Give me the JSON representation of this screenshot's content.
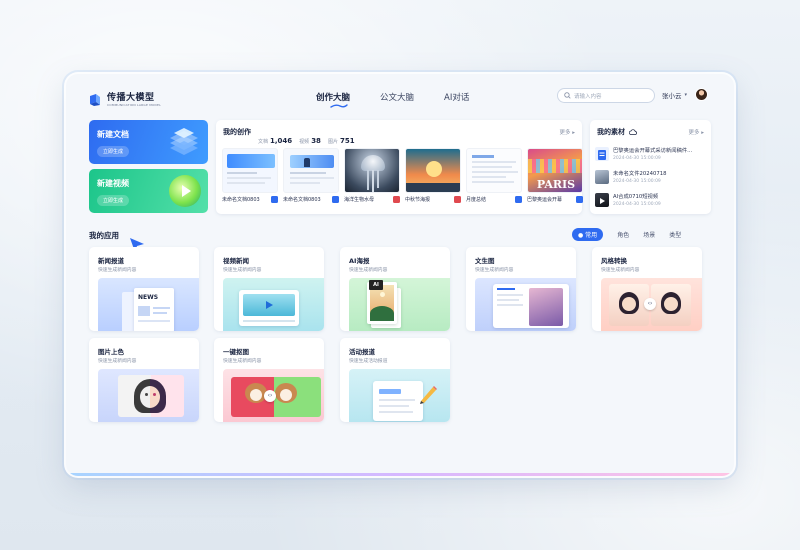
{
  "brand": {
    "name": "传播大模型",
    "subtitle": "COMMUNICATION LARGE MODEL"
  },
  "nav": {
    "tabs": [
      "创作大脑",
      "公文大脑",
      "AI对话"
    ],
    "active": 0
  },
  "search": {
    "placeholder": "请输入内容"
  },
  "user": {
    "name": "张小云"
  },
  "new_actions": [
    {
      "title": "新建文档",
      "button": "立即生成"
    },
    {
      "title": "新建视频",
      "button": "立即生成"
    }
  ],
  "my_creations": {
    "title": "我的创作",
    "stats": [
      {
        "label": "文档",
        "value": "1,046"
      },
      {
        "label": "视频",
        "value": "38"
      },
      {
        "label": "图片",
        "value": "751"
      }
    ],
    "more": "更多 ▸",
    "items": [
      {
        "name": "未命名文档0803",
        "badge_color": "#2f6bf0"
      },
      {
        "name": "未命名文档0803",
        "badge_color": "#2f6bf0"
      },
      {
        "name": "海洋生物水母",
        "badge_color": "#e0494f"
      },
      {
        "name": "中秋节海报",
        "badge_color": "#e0494f"
      },
      {
        "name": "月度总结",
        "badge_color": "#2f6bf0"
      },
      {
        "name": "巴黎奥运会开幕",
        "badge_color": "#2f6bf0"
      }
    ]
  },
  "my_materials": {
    "title": "我的素材",
    "more": "更多 ▸",
    "items": [
      {
        "name": "巴黎奥运会开幕式采访新闻稿件...",
        "date": "2024-04-30 15:00:09"
      },
      {
        "name": "未命名文件20240718",
        "date": "2024-04-30 15:00:09"
      },
      {
        "name": "AI合成0710短视频",
        "date": "2024-04-30 15:00:09"
      }
    ]
  },
  "apps": {
    "title": "我的应用",
    "filters": [
      "常用",
      "角色",
      "场景",
      "类型"
    ],
    "active_filter": 0,
    "news_word": "NEWS",
    "ai_word": "AI",
    "items": [
      {
        "name": "新闻报道",
        "desc": "快速生成新闻内容"
      },
      {
        "name": "视频新闻",
        "desc": "快速生成新闻内容"
      },
      {
        "name": "AI海报",
        "desc": "快速生成新闻内容"
      },
      {
        "name": "文生图",
        "desc": "快速生成新闻内容"
      },
      {
        "name": "风格转换",
        "desc": "快速生成新闻内容"
      },
      {
        "name": "图片上色",
        "desc": "快速生成新闻内容"
      },
      {
        "name": "一键抠图",
        "desc": "快速生成新闻内容"
      },
      {
        "name": "活动报道",
        "desc": "快速生成活动报道"
      }
    ]
  },
  "colors": {
    "primary": "#2f6bf0",
    "green": "#1cc58a",
    "text": "#1a2440"
  }
}
